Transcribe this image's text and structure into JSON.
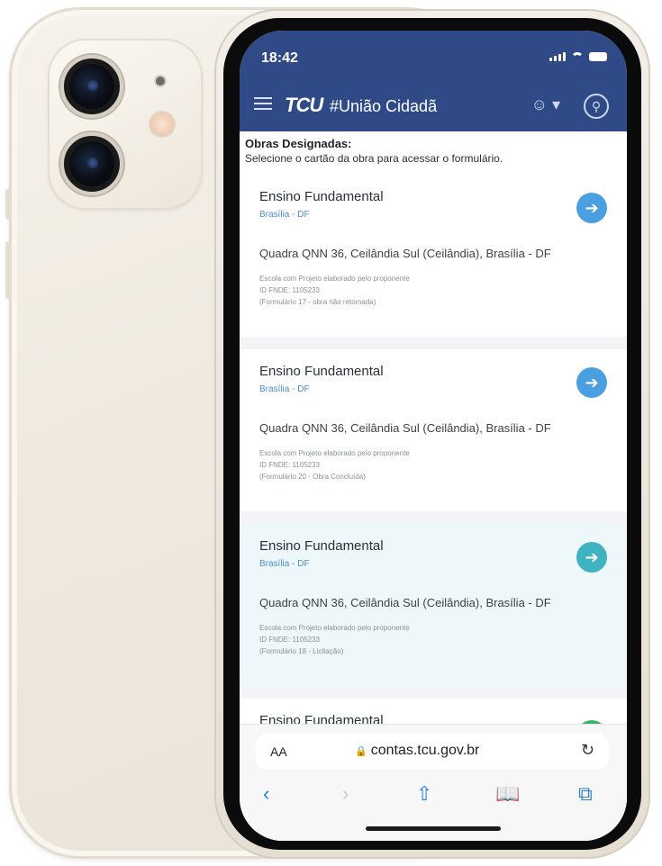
{
  "status_bar": {
    "time": "18:42"
  },
  "app_bar": {
    "logo": "TCU",
    "title": "#União Cidadã",
    "user_icon": "user-icon",
    "search_icon": "search-icon"
  },
  "intro": {
    "title": "Obras Designadas:",
    "subtitle": "Selecione o cartão da obra para acessar o formulário."
  },
  "cards": [
    {
      "title": "Ensino Fundamental",
      "location": "Brasília - DF",
      "address": "Quadra QNN 36, Ceilândia Sul (Ceilândia), Brasília - DF",
      "details": [
        "Escola com Projeto elaborado pelo proponente",
        "ID FNDE: 1105233",
        "(Formulário 17 - obra não retomada)"
      ],
      "action_icon": "arrow-right-icon"
    },
    {
      "title": "Ensino Fundamental",
      "location": "Brasília - DF",
      "address": "Quadra QNN 36, Ceilândia Sul (Ceilândia), Brasília - DF",
      "details": [
        "Escola com Projeto elaborado pelo proponente",
        "ID FNDE: 1105233",
        "(Formulário 20 - Obra Concluída)"
      ],
      "action_icon": "arrow-right-icon"
    },
    {
      "title": "Ensino Fundamental",
      "location": "Brasília - DF",
      "address": "Quadra QNN 36, Ceilândia Sul (Ceilândia), Brasília - DF",
      "details": [
        "Escola com Projeto elaborado pelo proponente",
        "ID FNDE: 1105233",
        "(Formulário 18 - Licitação)"
      ],
      "action_icon": "arrow-right-icon"
    },
    {
      "title": "Ensino Fundamental",
      "action_icon": "check-icon"
    }
  ],
  "browser": {
    "text_size_label": "AA",
    "url": "contas.tcu.gov.br",
    "reload_icon": "reload-icon",
    "nav": [
      "back-icon",
      "forward-icon",
      "share-icon",
      "bookmarks-icon",
      "tabs-icon"
    ]
  },
  "colors": {
    "header": "#2f4a86",
    "link": "#4a8fd6",
    "arrow": "#4a9fe0",
    "arrow_teal": "#3fb3c2",
    "check": "#3fb368"
  }
}
